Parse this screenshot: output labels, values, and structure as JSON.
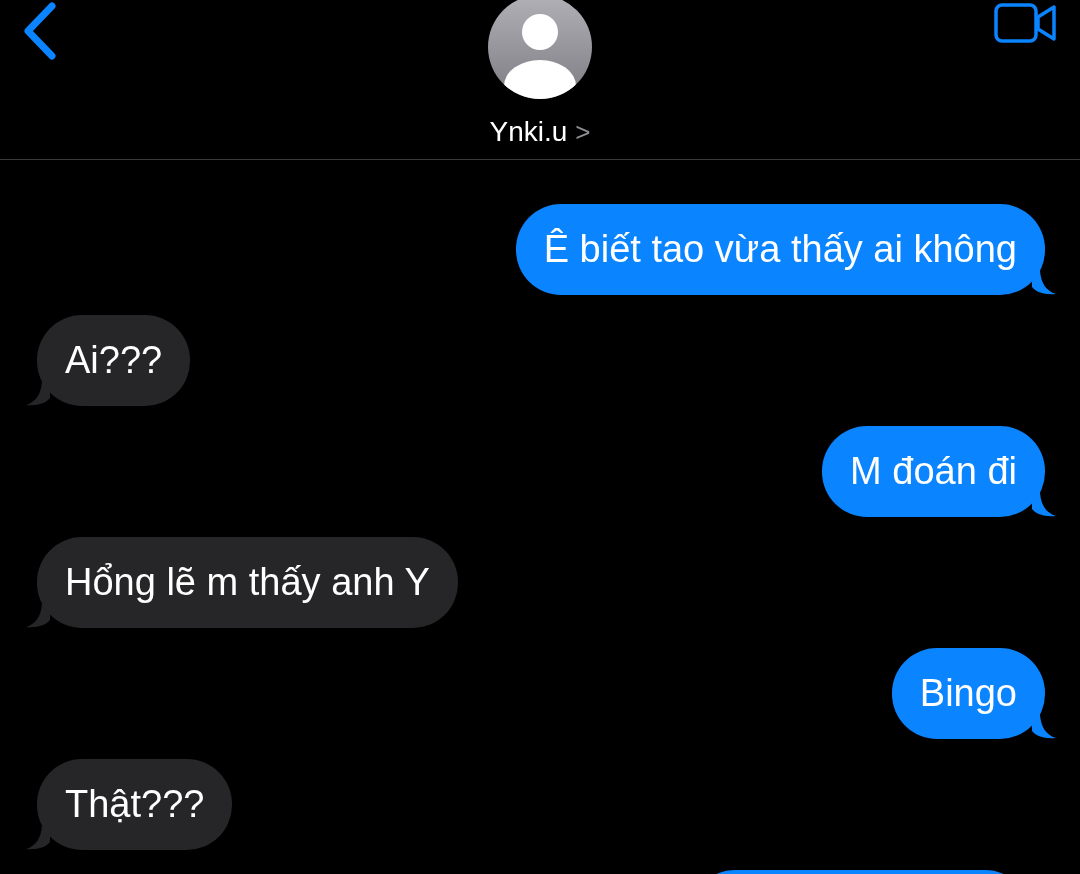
{
  "header": {
    "contact_name": "Ynki.u",
    "chevron": ">"
  },
  "messages": [
    {
      "kind": "sent",
      "text": "Ê biết tao vừa thấy ai không"
    },
    {
      "kind": "received",
      "text": "Ai???"
    },
    {
      "kind": "sent",
      "text": "M đoán đi"
    },
    {
      "kind": "received",
      "text": "Hổng lẽ m thấy anh Y"
    },
    {
      "kind": "sent",
      "text": "Bingo"
    },
    {
      "kind": "received",
      "text": "Thật???"
    },
    {
      "kind": "sent_partial"
    }
  ]
}
